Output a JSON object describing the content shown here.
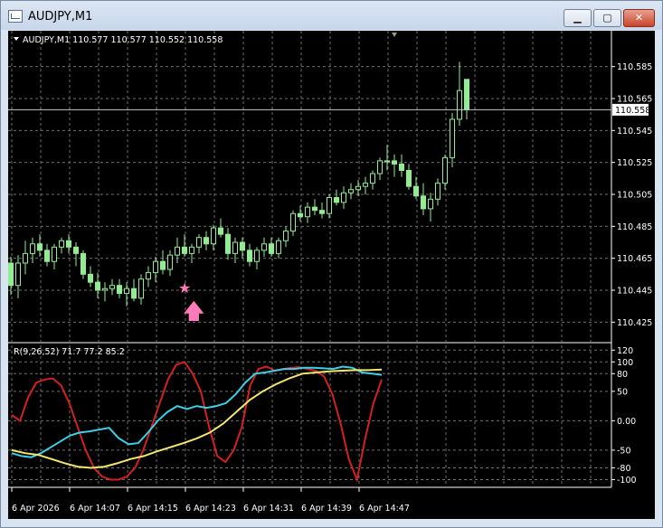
{
  "window": {
    "title": "AUDJPY,M1",
    "minimize_glyph": "▁",
    "maximize_glyph": "▢",
    "close_glyph": "✕"
  },
  "chart": {
    "header": "AUDJPY,M1  110.577 110.577 110.552 110.558",
    "price_ticks": [
      "110.585",
      "110.565",
      "110.545",
      "110.525",
      "110.505",
      "110.485",
      "110.465",
      "110.445",
      "110.425"
    ],
    "current_price": "110.558",
    "indicator_label": "R(9,26,52) 71.7 77.2 85.2",
    "indicator_ticks": [
      "120",
      "100",
      "80",
      "50",
      "0.00",
      "-50",
      "-80",
      "-100"
    ],
    "time_ticks": [
      "6 Apr 2026",
      "6 Apr 14:07",
      "6 Apr 14:15",
      "6 Apr 14:23",
      "6 Apr 14:31",
      "6 Apr 14:39",
      "6 Apr 14:47"
    ],
    "marker_star": "★",
    "marker_arrow": "🡅",
    "colors": {
      "background": "#000000",
      "grid": "#6e6e6e",
      "candle": "#90ee90",
      "text": "#ffffff",
      "red": "#d42020",
      "cyan": "#3cd0e6",
      "yellow": "#f2e870",
      "arrow": "#ff7ab8"
    }
  },
  "chart_data": [
    {
      "type": "candlestick",
      "title": "AUDJPY,M1",
      "ylim": [
        110.415,
        110.595
      ],
      "current": 110.558,
      "ohlc": [
        [
          110.462,
          110.466,
          110.442,
          110.448
        ],
        [
          110.448,
          110.467,
          110.44,
          110.462
        ],
        [
          110.462,
          110.476,
          110.455,
          110.468
        ],
        [
          110.468,
          110.478,
          110.462,
          110.474
        ],
        [
          110.474,
          110.48,
          110.466,
          110.47
        ],
        [
          110.47,
          110.474,
          110.46,
          110.463
        ],
        [
          110.463,
          110.474,
          110.458,
          110.472
        ],
        [
          110.472,
          110.478,
          110.468,
          110.476
        ],
        [
          110.476,
          110.48,
          110.468,
          110.472
        ],
        [
          110.472,
          110.475,
          110.46,
          110.468
        ],
        [
          110.468,
          110.47,
          110.452,
          110.455
        ],
        [
          110.455,
          110.46,
          110.447,
          110.45
        ],
        [
          110.45,
          110.456,
          110.44,
          110.445
        ],
        [
          110.445,
          110.45,
          110.438,
          110.446
        ],
        [
          110.446,
          110.452,
          110.442,
          110.448
        ],
        [
          110.448,
          110.452,
          110.44,
          110.443
        ],
        [
          110.443,
          110.45,
          110.435,
          110.446
        ],
        [
          110.446,
          110.452,
          110.438,
          110.44
        ],
        [
          110.44,
          110.455,
          110.436,
          110.452
        ],
        [
          110.452,
          110.46,
          110.447,
          110.456
        ],
        [
          110.456,
          110.466,
          110.45,
          110.463
        ],
        [
          110.463,
          110.47,
          110.455,
          110.458
        ],
        [
          110.458,
          110.47,
          110.454,
          110.467
        ],
        [
          110.467,
          110.478,
          110.462,
          110.472
        ],
        [
          110.472,
          110.48,
          110.466,
          110.468
        ],
        [
          110.468,
          110.474,
          110.462,
          110.472
        ],
        [
          110.472,
          110.48,
          110.468,
          110.478
        ],
        [
          110.478,
          110.482,
          110.47,
          110.474
        ],
        [
          110.474,
          110.486,
          110.47,
          110.484
        ],
        [
          110.484,
          110.49,
          110.478,
          110.48
        ],
        [
          110.48,
          110.484,
          110.464,
          110.468
        ],
        [
          110.468,
          110.478,
          110.462,
          110.475
        ],
        [
          110.475,
          110.478,
          110.465,
          110.47
        ],
        [
          110.47,
          110.474,
          110.46,
          110.463
        ],
        [
          110.463,
          110.472,
          110.458,
          110.47
        ],
        [
          110.47,
          110.478,
          110.466,
          110.474
        ],
        [
          110.474,
          110.478,
          110.466,
          110.468
        ],
        [
          110.468,
          110.478,
          110.465,
          110.476
        ],
        [
          110.476,
          110.485,
          110.472,
          110.482
        ],
        [
          110.482,
          110.495,
          110.479,
          110.493
        ],
        [
          110.493,
          110.498,
          110.488,
          110.491
        ],
        [
          110.491,
          110.5,
          110.487,
          110.497
        ],
        [
          110.497,
          110.502,
          110.492,
          110.495
        ],
        [
          110.495,
          110.5,
          110.49,
          110.493
        ],
        [
          110.493,
          110.505,
          110.49,
          110.503
        ],
        [
          110.503,
          110.508,
          110.498,
          110.5
        ],
        [
          110.5,
          110.51,
          110.496,
          110.506
        ],
        [
          110.506,
          110.512,
          110.502,
          110.508
        ],
        [
          110.508,
          110.514,
          110.504,
          110.51
        ],
        [
          110.51,
          110.516,
          110.505,
          110.512
        ],
        [
          110.512,
          110.52,
          110.508,
          110.518
        ],
        [
          110.518,
          110.528,
          110.514,
          110.526
        ],
        [
          110.526,
          110.536,
          110.52,
          110.526
        ],
        [
          110.526,
          110.53,
          110.516,
          110.524
        ],
        [
          110.524,
          110.53,
          110.516,
          110.52
        ],
        [
          110.52,
          110.524,
          110.508,
          110.51
        ],
        [
          110.51,
          110.516,
          110.502,
          110.504
        ],
        [
          110.504,
          110.512,
          110.492,
          110.496
        ],
        [
          110.496,
          110.506,
          110.488,
          110.502
        ],
        [
          110.502,
          110.515,
          110.498,
          110.512
        ],
        [
          110.512,
          110.53,
          110.508,
          110.528
        ],
        [
          110.528,
          110.556,
          110.522,
          110.552
        ],
        [
          110.552,
          110.588,
          110.548,
          110.57
        ],
        [
          110.577,
          110.577,
          110.552,
          110.558
        ]
      ]
    },
    {
      "type": "line",
      "title": "R(9,26,52)",
      "ylim": [
        -110,
        125
      ],
      "series": [
        {
          "color": "red",
          "last": 71.7,
          "values": [
            10,
            0,
            40,
            65,
            70,
            72,
            60,
            30,
            -10,
            -50,
            -80,
            -95,
            -100,
            -100,
            -95,
            -80,
            -50,
            -10,
            30,
            70,
            95,
            100,
            80,
            50,
            -10,
            -60,
            -70,
            -50,
            -10,
            60,
            88,
            92,
            85,
            88,
            90,
            91,
            88,
            85,
            75,
            45,
            -5,
            -65,
            -100,
            -30,
            30,
            70
          ]
        },
        {
          "color": "cyan",
          "last": 77.2,
          "values": [
            -55,
            -60,
            -62,
            -55,
            -45,
            -35,
            -25,
            -20,
            -18,
            -15,
            -12,
            -30,
            -40,
            -38,
            -20,
            0,
            15,
            25,
            20,
            25,
            22,
            25,
            30,
            45,
            65,
            80,
            82,
            85,
            88,
            88,
            90,
            90,
            89,
            88,
            92,
            90,
            82,
            80,
            78
          ]
        },
        {
          "color": "yellow",
          "last": 85.2,
          "values": [
            -50,
            -55,
            -58,
            -65,
            -72,
            -78,
            -80,
            -78,
            -72,
            -65,
            -60,
            -52,
            -45,
            -38,
            -30,
            -20,
            -5,
            15,
            35,
            50,
            62,
            72,
            80,
            82,
            84,
            85,
            86,
            86,
            87
          ]
        }
      ]
    }
  ]
}
